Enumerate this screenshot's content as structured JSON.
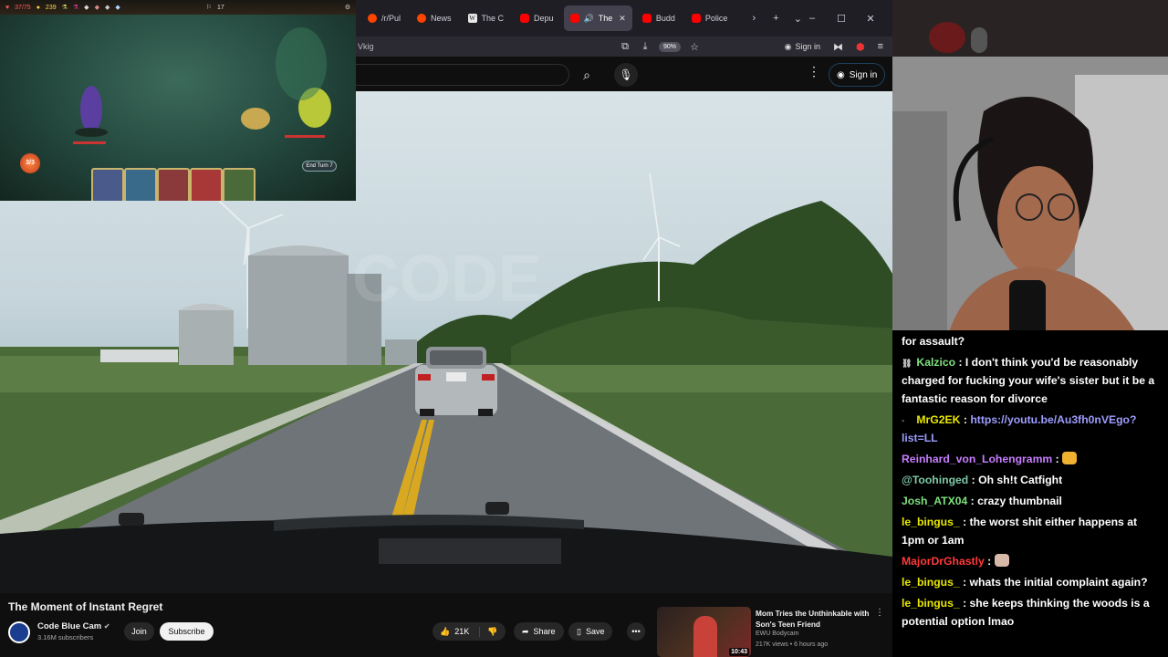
{
  "game": {
    "hp": "37/75",
    "gold": "239",
    "floor": "17",
    "energy": "3/3",
    "end_turn_label": "End Turn 7"
  },
  "browser": {
    "tabs": [
      {
        "label": "/r/Pul",
        "icon": "reddit-icon"
      },
      {
        "label": "News",
        "icon": "reddit-icon"
      },
      {
        "label": "The C",
        "icon": "wikipedia-icon"
      },
      {
        "label": "Depu",
        "icon": "youtube-icon"
      },
      {
        "label": "The",
        "icon": "youtube-icon",
        "active": true
      },
      {
        "label": "Budd",
        "icon": "youtube-icon"
      },
      {
        "label": "Police",
        "icon": "youtube-icon"
      }
    ],
    "url": "Vkig",
    "zoom": "90%",
    "signin": "Sign in"
  },
  "youtube": {
    "signin": "Sign in",
    "video_title": "The Moment of Instant Regret",
    "channel": "Code Blue Cam",
    "subscribers": "3.16M subscribers",
    "join": "Join",
    "subscribe": "Subscribe",
    "likes": "21K",
    "share": "Share",
    "save": "Save",
    "recommendation": {
      "title": "Mom Tries the Unthinkable with Son's Teen Friend",
      "channel": "EWU Bodycam",
      "meta": "217K views • 6 hours ago",
      "duration": "10:43"
    }
  },
  "chat": {
    "messages": [
      {
        "user": "",
        "color": "#ffffff",
        "text": "for assault?"
      },
      {
        "user": "Kalzico",
        "color": "#7ee07e",
        "badge": true,
        "text": "I don't think you'd be reasonably charged for fucking your wife's sister but it be a fantastic reason for divorce"
      },
      {
        "user": "MrG2EK",
        "color": "#e8e800",
        "badge": true,
        "text": "https://youtu.be/Au3fh0nVEgo?list=LL",
        "link": true
      },
      {
        "user": "Reinhard_von_Lohengramm",
        "color": "#c77dff",
        "text": "",
        "emote": true
      },
      {
        "user": "@Toohinged",
        "color": "#7ec9a8",
        "text": "Oh sh!t Catfight"
      },
      {
        "user": "Josh_ATX04",
        "color": "#7ee07e",
        "text": "crazy thumbnail"
      },
      {
        "user": "le_bingus_",
        "color": "#e8e800",
        "text": "the worst shit either happens at 1pm or 1am"
      },
      {
        "user": "MajorDrGhastly",
        "color": "#ff3a3a",
        "text": "",
        "emote": true
      },
      {
        "user": "le_bingus_",
        "color": "#e8e800",
        "text": "whats the initial complaint again?"
      },
      {
        "user": "le_bingus_",
        "color": "#e8e800",
        "text": "she keeps thinking the woods is a potential option lmao"
      }
    ]
  }
}
